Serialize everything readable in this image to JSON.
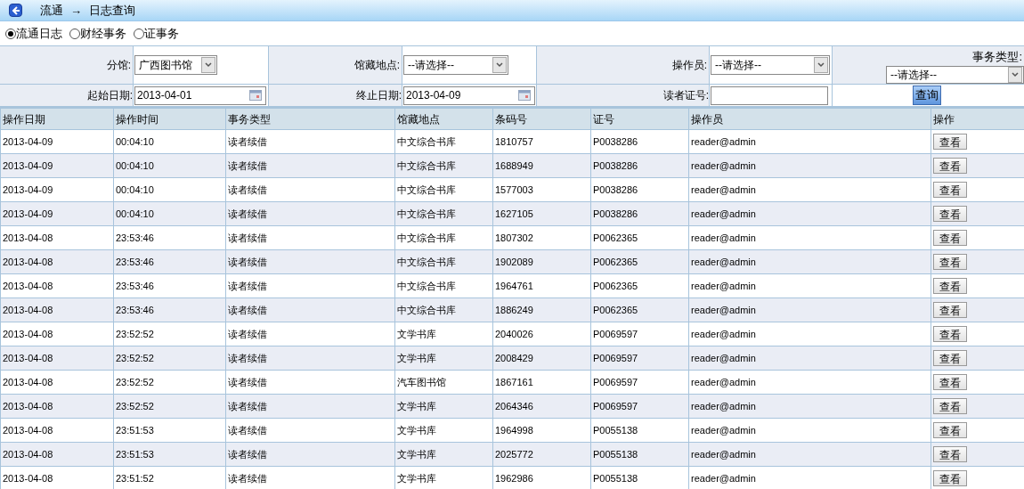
{
  "title_bar": {
    "items": [
      "流通",
      "→",
      "日志查询"
    ]
  },
  "log_types": [
    {
      "label": "流通日志",
      "selected": true
    },
    {
      "label": "财经事务",
      "selected": false
    },
    {
      "label": "证事务",
      "selected": false
    }
  ],
  "filters": {
    "row_1": [
      {
        "label": "分馆:",
        "kind": "select",
        "value": "广西图书馆"
      },
      {
        "label": "馆藏地点:",
        "kind": "select",
        "value": "--请选择--"
      },
      {
        "label": "操作员:",
        "kind": "select",
        "value": "--请选择--"
      },
      {
        "label": "事务类型:",
        "kind": "select",
        "value": "--请选择--"
      }
    ],
    "row_2": [
      {
        "label": "起始日期:",
        "kind": "date",
        "value": "2013-04-01"
      },
      {
        "label": "终止日期:",
        "kind": "date",
        "value": "2013-04-09"
      },
      {
        "label": "读者证号:",
        "kind": "text"
      }
    ],
    "query_button": "查询"
  },
  "table": {
    "columns": [
      "操作日期",
      "操作时间",
      "事务类型",
      "馆藏地点",
      "条码号",
      "证号",
      "操作员",
      "操作"
    ],
    "rows": [
      [
        "2013-04-09",
        "00:04:10",
        "读者续借",
        "中文综合书库",
        "1810757",
        "P0038286",
        "reader@admin",
        "查看"
      ],
      [
        "2013-04-09",
        "00:04:10",
        "读者续借",
        "中文综合书库",
        "1688949",
        "P0038286",
        "reader@admin",
        "查看"
      ],
      [
        "2013-04-09",
        "00:04:10",
        "读者续借",
        "中文综合书库",
        "1577003",
        "P0038286",
        "reader@admin",
        "查看"
      ],
      [
        "2013-04-09",
        "00:04:10",
        "读者续借",
        "中文综合书库",
        "1627105",
        "P0038286",
        "reader@admin",
        "查看"
      ],
      [
        "2013-04-08",
        "23:53:46",
        "读者续借",
        "中文综合书库",
        "1807302",
        "P0062365",
        "reader@admin",
        "查看"
      ],
      [
        "2013-04-08",
        "23:53:46",
        "读者续借",
        "中文综合书库",
        "1902089",
        "P0062365",
        "reader@admin",
        "查看"
      ],
      [
        "2013-04-08",
        "23:53:46",
        "读者续借",
        "中文综合书库",
        "1964761",
        "P0062365",
        "reader@admin",
        "查看"
      ],
      [
        "2013-04-08",
        "23:53:46",
        "读者续借",
        "中文综合书库",
        "1886249",
        "P0062365",
        "reader@admin",
        "查看"
      ],
      [
        "2013-04-08",
        "23:52:52",
        "读者续借",
        "文学书库",
        "2040026",
        "P0069597",
        "reader@admin",
        "查看"
      ],
      [
        "2013-04-08",
        "23:52:52",
        "读者续借",
        "文学书库",
        "2008429",
        "P0069597",
        "reader@admin",
        "查看"
      ],
      [
        "2013-04-08",
        "23:52:52",
        "读者续借",
        "汽车图书馆",
        "1867161",
        "P0069597",
        "reader@admin",
        "查看"
      ],
      [
        "2013-04-08",
        "23:52:52",
        "读者续借",
        "文学书库",
        "2064346",
        "P0069597",
        "reader@admin",
        "查看"
      ],
      [
        "2013-04-08",
        "23:51:53",
        "读者续借",
        "文学书库",
        "1964998",
        "P0055138",
        "reader@admin",
        "查看"
      ],
      [
        "2013-04-08",
        "23:51:53",
        "读者续借",
        "文学书库",
        "2025772",
        "P0055138",
        "reader@admin",
        "查看"
      ],
      [
        "2013-04-08",
        "23:51:52",
        "读者续借",
        "文学书库",
        "1962986",
        "P0055138",
        "reader@admin",
        "查看"
      ]
    ]
  }
}
